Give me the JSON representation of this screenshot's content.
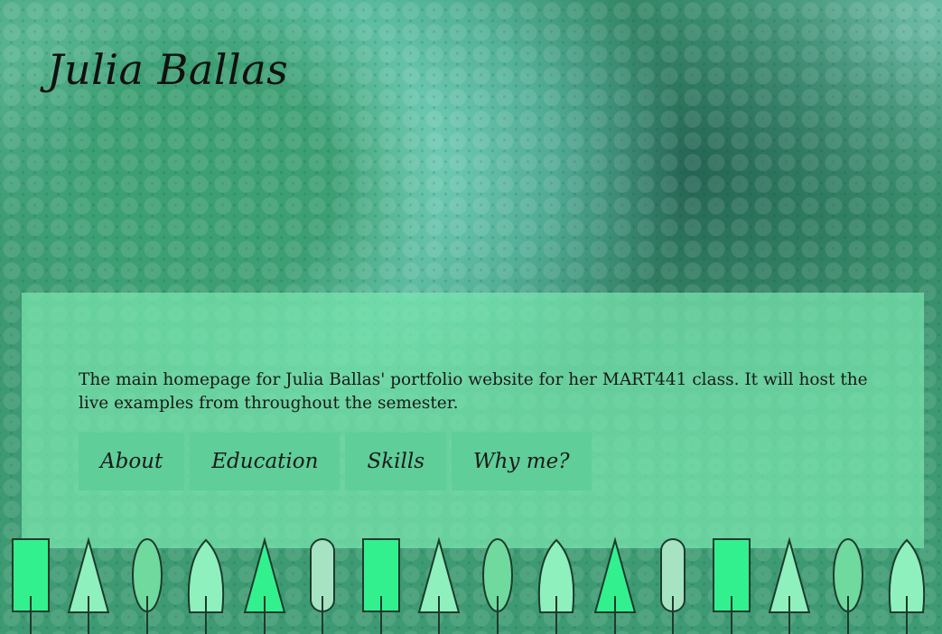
{
  "header": {
    "site_title": "Julia Ballas"
  },
  "main": {
    "intro_text": "The main homepage for Julia Ballas' portfolio website for her MART441 class. It will host the live examples from throughout the semester.",
    "nav": [
      {
        "label": "About"
      },
      {
        "label": "Education"
      },
      {
        "label": "Skills"
      },
      {
        "label": "Why me?"
      }
    ]
  },
  "colors": {
    "background": "#3d9a72",
    "panel": "#78e6af",
    "nav_button": "#5fce99",
    "tree_bright": "#33f08f",
    "tree_light": "#8ef0bd",
    "tree_pale": "#a6e3c3",
    "tree_mid": "#6fd99e",
    "tree_outline": "#1d3b2c"
  },
  "decor": {
    "tree_row_icons": [
      "rectangle-tree-icon",
      "triangle-tree-icon",
      "oval-tree-icon",
      "pointed-tree-icon",
      "triangle-tree-icon",
      "capsule-tree-icon",
      "rectangle-tree-icon",
      "triangle-tree-icon",
      "oval-tree-icon",
      "pointed-tree-icon",
      "triangle-tree-icon",
      "capsule-tree-icon",
      "rectangle-tree-icon",
      "triangle-tree-icon",
      "oval-tree-icon",
      "pointed-tree-icon"
    ]
  }
}
